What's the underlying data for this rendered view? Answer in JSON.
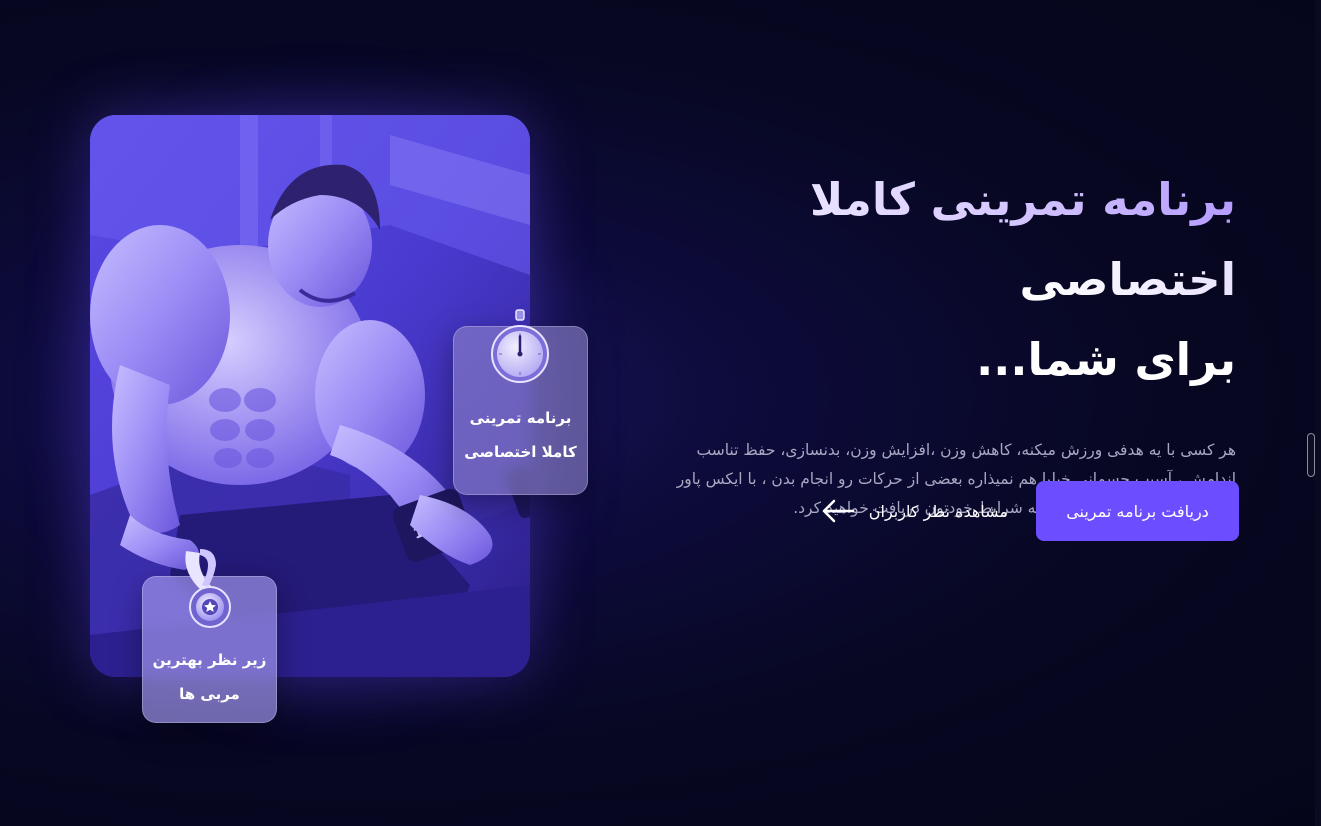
{
  "hero": {
    "headline_line1": "برنامه تمرینی کاملا اختصاصی",
    "headline_line2": "برای شما...",
    "description": "هر کسی با یه هدفی ورزش میکنه، کاهش وزن ،افزایش وزن، بدنسازی، حفظ تناسب اندامش ، آسیب جسمانی خیلیا هم نمیذاره بعضی از حرکات رو انجام بدن ، با ایکس پاور یه برنامه ورزشی کاملا مختص به شرایط خودتون دریافت خواهید کرد.",
    "primary_button_label": "دریافت برنامه تمرینی",
    "secondary_link_label": "مشاهده نظر کاربران"
  },
  "badges": {
    "program": {
      "line1": "برنامه تمرینی",
      "line2": "کاملا اختصاصی",
      "icon": "stopwatch-icon"
    },
    "coach": {
      "line1": "زیر نظر بهترین",
      "line2": "مربی ها",
      "icon": "medal-icon"
    }
  },
  "image": {
    "subject": "bodybuilder-dumbbell-photo",
    "dumbbell_text": "10KG"
  },
  "colors": {
    "background": "#070722",
    "accent": "#6c4dff",
    "headline_accent": "#b59cff",
    "body_text": "#a9a7c2"
  }
}
